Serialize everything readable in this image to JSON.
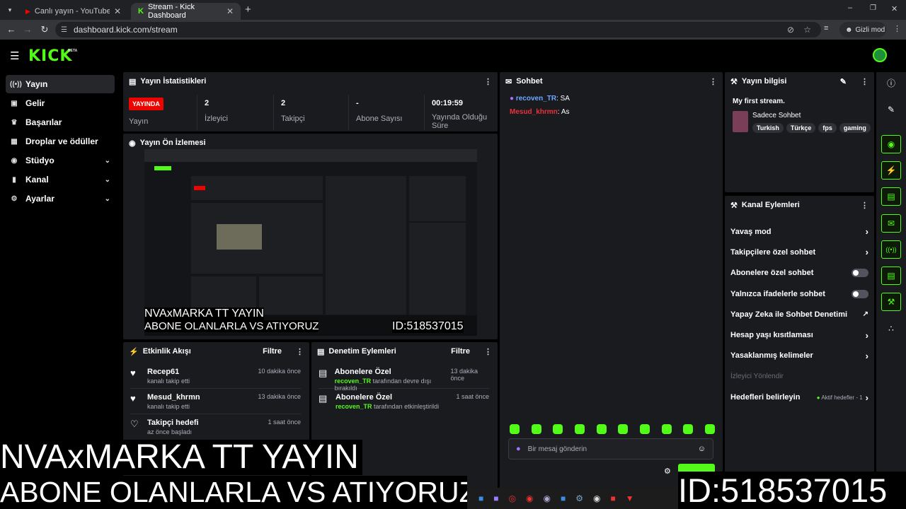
{
  "browser": {
    "tabs": [
      {
        "label": "Canlı yayın - YouTube Stüdyosu"
      },
      {
        "label": "Stream - Kick Dashboard"
      }
    ],
    "url": "dashboard.kick.com/stream",
    "incognito_label": "Gizli mod"
  },
  "app": {
    "logo": "KICK",
    "logo_badge": "BETA"
  },
  "sidebar": {
    "items": [
      {
        "label": "Yayın",
        "icon": "broadcast-icon"
      },
      {
        "label": "Gelir",
        "icon": "revenue-icon"
      },
      {
        "label": "Başarılar",
        "icon": "trophy-icon"
      },
      {
        "label": "Droplar ve ödüller",
        "icon": "rewards-icon"
      },
      {
        "label": "Stüdyo",
        "icon": "studio-icon"
      },
      {
        "label": "Kanal",
        "icon": "channel-icon"
      },
      {
        "label": "Ayarlar",
        "icon": "gear-icon"
      }
    ]
  },
  "stats": {
    "title": "Yayın İstatistikleri",
    "live_badge": "YAYINDA",
    "live_label": "Yayın",
    "viewers_value": "2",
    "viewers_label": "İzleyici",
    "followers_value": "2",
    "followers_label": "Takipçi",
    "subs_value": "-",
    "subs_label": "Abone Sayısı",
    "duration_value": "00:19:59",
    "duration_label": "Yayında Olduğu Süre"
  },
  "preview": {
    "title": "Yayın Ön İzlemesi",
    "overlay_line1": "NVAxMARKA TT YAYIN",
    "overlay_line2": "ABONE OLANLARLA VS ATIYORUZ",
    "overlay_id": "ID:518537015"
  },
  "events": {
    "title": "Etkinlik Akışı",
    "filter": "Filtre",
    "items": [
      {
        "name": "Recep61",
        "sub": "kanalı takip etti",
        "time": "10 dakika önce"
      },
      {
        "name": "Mesud_khrmn",
        "sub": "kanalı takip etti",
        "time": "13 dakika önce"
      },
      {
        "name": "Takipçi hedefi",
        "sub": "az önce başladı",
        "time": "1 saat önce"
      }
    ]
  },
  "moderation": {
    "title": "Denetim Eylemleri",
    "filter": "Filtre",
    "items": [
      {
        "name": "Abonelere Özel",
        "user": "recoven_TR",
        "sub": "tarafından devre dışı bırakıldı",
        "time": "13 dakika önce"
      },
      {
        "name": "Abonelere Özel",
        "user": "recoven_TR",
        "sub": "tarafından etkinleştirildi",
        "time": "1 saat önce"
      }
    ]
  },
  "chat": {
    "title": "Sohbet",
    "messages": [
      {
        "user": "recoven_TR",
        "text": "SA",
        "color": "#6ea8ff"
      },
      {
        "user": "Mesud_khrmn",
        "text": "As",
        "color": "#e8323c"
      }
    ],
    "placeholder": "Bir mesaj gönderin"
  },
  "stream_info": {
    "title": "Yayın bilgisi",
    "stream_title": "My first stream.",
    "category": "Sadece Sohbet",
    "tags": [
      "Turkish",
      "Türkçe",
      "fps",
      "gaming"
    ]
  },
  "channel_actions": {
    "title": "Kanal Eylemleri",
    "items": [
      {
        "label": "Yavaş mod",
        "kind": "chevron"
      },
      {
        "label": "Takipçilere özel sohbet",
        "kind": "chevron"
      },
      {
        "label": "Abonelere özel sohbet",
        "kind": "toggle"
      },
      {
        "label": "Yalnızca ifadelerle sohbet",
        "kind": "toggle"
      },
      {
        "label": "Yapay Zeka ile Sohbet Denetimi",
        "kind": "external"
      },
      {
        "label": "Hesap yaşı kısıtlaması",
        "kind": "chevron"
      },
      {
        "label": "Yasaklanmış kelimeler",
        "kind": "chevron"
      }
    ],
    "section_label": "İzleyici Yönlendir",
    "goals_label": "Hedefleri belirleyin",
    "goals_status": "Aktif hedefler - 1"
  },
  "overlay": {
    "line1": "NVAxMARKA TT YAYIN",
    "line2": "ABONE OLANLARLA VS ATIYORUZ",
    "id": "ID:518537015"
  },
  "colors": {
    "accent": "#53fc18",
    "live": "#eb0400",
    "panel": "#191b1f"
  }
}
